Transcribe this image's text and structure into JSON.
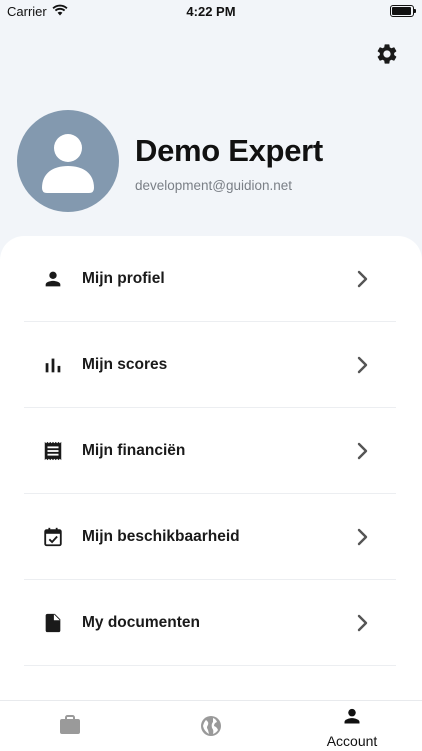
{
  "status_bar": {
    "carrier": "Carrier",
    "time": "4:22 PM"
  },
  "profile": {
    "name": "Demo Expert",
    "email": "development@guidion.net"
  },
  "menu": {
    "items": [
      {
        "label": "Mijn profiel",
        "icon": "person-icon"
      },
      {
        "label": "Mijn scores",
        "icon": "bar-chart-icon"
      },
      {
        "label": "Mijn financiën",
        "icon": "receipt-icon"
      },
      {
        "label": "Mijn beschikbaarheid",
        "icon": "calendar-check-icon"
      },
      {
        "label": "My documenten",
        "icon": "document-icon"
      }
    ]
  },
  "tab_bar": {
    "tabs": [
      {
        "icon": "briefcase-icon",
        "label": ""
      },
      {
        "icon": "globe-icon",
        "label": ""
      },
      {
        "icon": "account-icon",
        "label": "Account"
      }
    ],
    "active_index": 2
  },
  "colors": {
    "background": "#f2f5f9",
    "avatar": "#8399af",
    "card": "#ffffff",
    "icon": "#1a1a1a",
    "inactive_tab": "#9a9a9a"
  }
}
